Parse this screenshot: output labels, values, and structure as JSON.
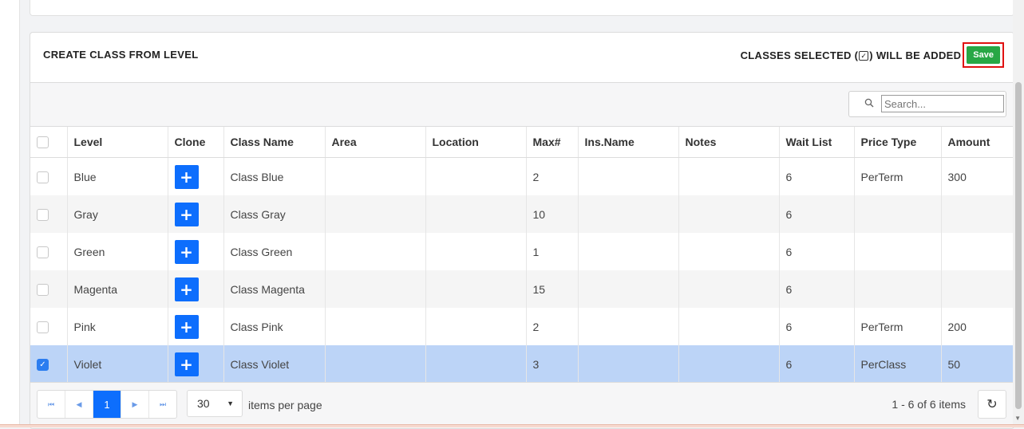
{
  "panel": {
    "title": "CREATE CLASS FROM LEVEL",
    "selected_text_prefix": "CLASSES SELECTED (",
    "selected_text_suffix": ") WILL BE ADDED",
    "save_label": "Save"
  },
  "search": {
    "placeholder": "Search..."
  },
  "table": {
    "headers": [
      "Level",
      "Clone",
      "Class Name",
      "Area",
      "Location",
      "Max#",
      "Ins.Name",
      "Notes",
      "Wait List",
      "Price Type",
      "Amount"
    ],
    "rows": [
      {
        "checked": false,
        "level": "Blue",
        "clone": "+",
        "class_name": "Class Blue",
        "area": "",
        "location": "",
        "max": "2",
        "ins_name": "",
        "notes": "",
        "wait_list": "6",
        "price_type": "PerTerm",
        "amount": "300"
      },
      {
        "checked": false,
        "level": "Gray",
        "clone": "+",
        "class_name": "Class Gray",
        "area": "",
        "location": "",
        "max": "10",
        "ins_name": "",
        "notes": "",
        "wait_list": "6",
        "price_type": "",
        "amount": ""
      },
      {
        "checked": false,
        "level": "Green",
        "clone": "+",
        "class_name": "Class Green",
        "area": "",
        "location": "",
        "max": "1",
        "ins_name": "",
        "notes": "",
        "wait_list": "6",
        "price_type": "",
        "amount": ""
      },
      {
        "checked": false,
        "level": "Magenta",
        "clone": "+",
        "class_name": "Class Magenta",
        "area": "",
        "location": "",
        "max": "15",
        "ins_name": "",
        "notes": "",
        "wait_list": "6",
        "price_type": "",
        "amount": ""
      },
      {
        "checked": false,
        "level": "Pink",
        "clone": "+",
        "class_name": "Class Pink",
        "area": "",
        "location": "",
        "max": "2",
        "ins_name": "",
        "notes": "",
        "wait_list": "6",
        "price_type": "PerTerm",
        "amount": "200"
      },
      {
        "checked": true,
        "level": "Violet",
        "clone": "+",
        "class_name": "Class Violet",
        "area": "",
        "location": "",
        "max": "3",
        "ins_name": "",
        "notes": "",
        "wait_list": "6",
        "price_type": "PerClass",
        "amount": "50"
      }
    ]
  },
  "pager": {
    "current_page": "1",
    "page_size": "30",
    "items_per_page_label": "items per page",
    "info": "1 - 6 of 6 items"
  },
  "colors": {
    "accent": "#0d6efd",
    "save_green": "#28a745",
    "selected_row": "#bcd4f7",
    "highlight_border": "#e01111"
  }
}
